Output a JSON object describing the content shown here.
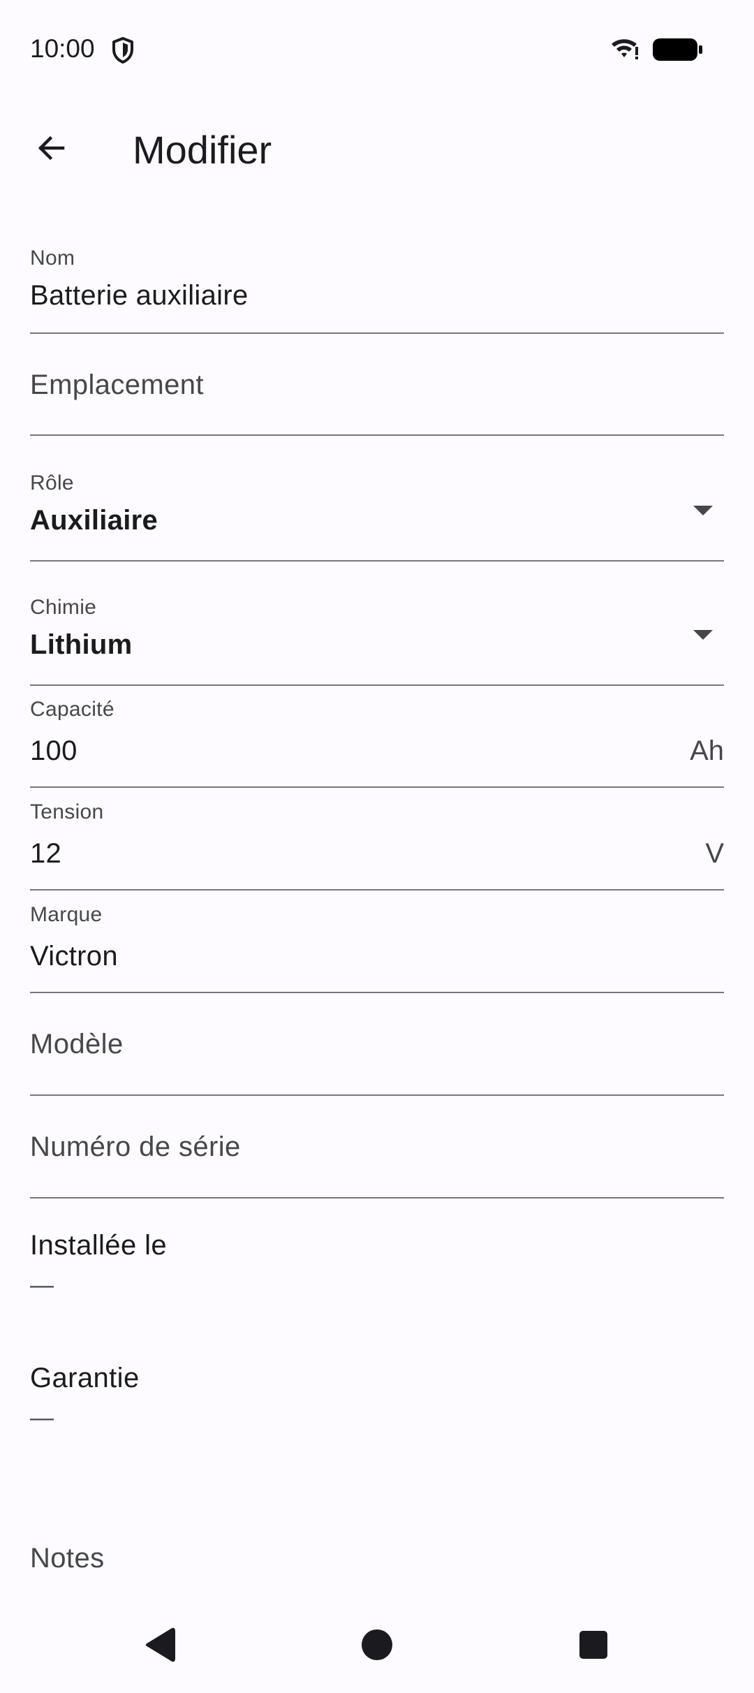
{
  "status_bar": {
    "time": "10:00"
  },
  "app_bar": {
    "title": "Modifier"
  },
  "form": {
    "nom": {
      "label": "Nom",
      "value": "Batterie auxiliaire"
    },
    "emplacement": {
      "placeholder": "Emplacement"
    },
    "role": {
      "label": "Rôle",
      "value": "Auxiliaire"
    },
    "chimie": {
      "label": "Chimie",
      "value": "Lithium"
    },
    "capacite": {
      "label": "Capacité",
      "value": "100",
      "suffix": "Ah"
    },
    "tension": {
      "label": "Tension",
      "value": "12",
      "suffix": "V"
    },
    "marque": {
      "label": "Marque",
      "value": "Victron"
    },
    "modele": {
      "placeholder": "Modèle"
    },
    "numero_serie": {
      "placeholder": "Numéro de série"
    },
    "installee_le": {
      "title": "Installée le",
      "value": "—"
    },
    "garantie": {
      "title": "Garantie",
      "value": "—"
    },
    "notes": {
      "placeholder": "Notes"
    }
  },
  "icons": {
    "back": "arrow-back-icon",
    "shield": "shield-icon",
    "wifi": "wifi-icon",
    "battery": "battery-icon",
    "nav_back": "nav-back-icon",
    "nav_home": "nav-home-icon",
    "nav_recents": "nav-recents-icon"
  },
  "colors": {
    "background": "#fdfbff",
    "text_primary": "#1b1b1f",
    "text_secondary": "#46464f",
    "underline": "#77767a"
  }
}
